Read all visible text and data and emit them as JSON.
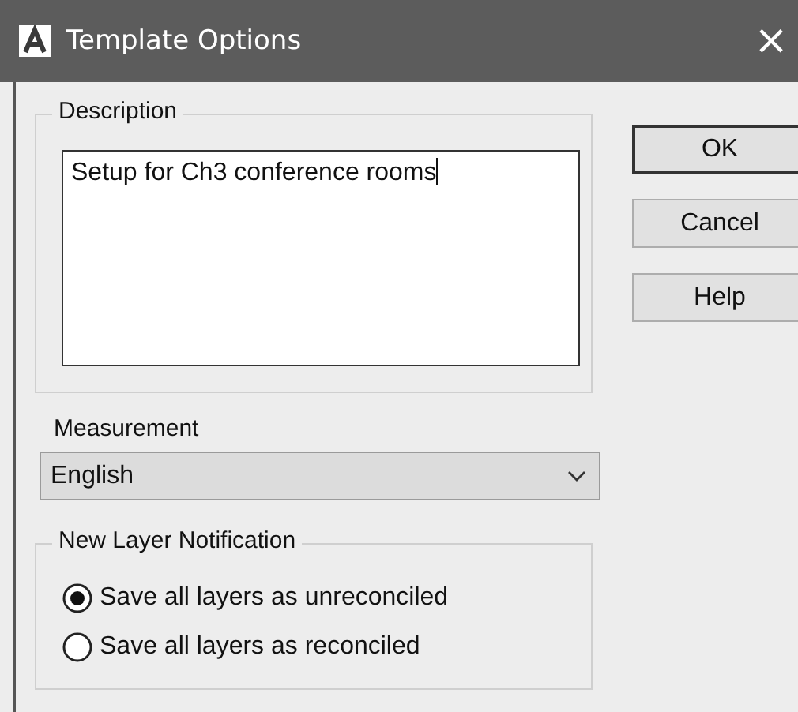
{
  "window": {
    "title": "Template Options",
    "close": "×"
  },
  "description": {
    "label": "Description",
    "value": "Setup for Ch3 conference rooms"
  },
  "buttons": [
    {
      "label": "OK",
      "default": true
    },
    {
      "label": "Cancel",
      "default": false
    },
    {
      "label": "Help",
      "default": false
    }
  ],
  "measurement": {
    "label": "Measurement",
    "value": "English"
  },
  "new_layer_notification": {
    "label": "New Layer Notification",
    "options": [
      {
        "label": "Save all layers as unreconciled",
        "selected": true
      },
      {
        "label": "Save all layers as reconciled",
        "selected": false
      }
    ]
  }
}
